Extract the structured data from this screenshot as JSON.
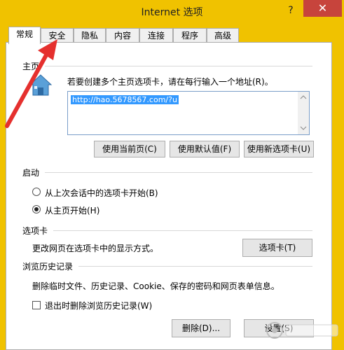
{
  "window": {
    "title": "Internet 选项",
    "help": "?",
    "close": "✕"
  },
  "tabs": [
    {
      "label": "常规"
    },
    {
      "label": "安全"
    },
    {
      "label": "隐私"
    },
    {
      "label": "内容"
    },
    {
      "label": "连接"
    },
    {
      "label": "程序"
    },
    {
      "label": "高级"
    }
  ],
  "home": {
    "section": "主页",
    "description": "若要创建多个主页选项卡，请在每行输入一个地址(R)。",
    "url": "http://hao.5678567.com/?u",
    "buttons": {
      "current": "使用当前页(C)",
      "default": "使用默认值(F)",
      "new_tab": "使用新选项卡(U)"
    }
  },
  "startup": {
    "section": "启动",
    "options": [
      {
        "label": "从上次会话中的选项卡开始(B)",
        "checked": false
      },
      {
        "label": "从主页开始(H)",
        "checked": true
      }
    ]
  },
  "tabs_section": {
    "section": "选项卡",
    "description": "更改网页在选项卡中的显示方式。",
    "button": "选项卡(T)"
  },
  "history": {
    "section": "浏览历史记录",
    "description": "删除临时文件、历史记录、Cookie、保存的密码和网页表单信息。",
    "checkbox": "退出时删除浏览历史记录(W)",
    "delete_button": "删除(D)...",
    "settings_button": "设置(S)"
  },
  "colors": {
    "titlebar": "#f0c200",
    "close": "#c7443c",
    "arrow": "#e5302e"
  }
}
